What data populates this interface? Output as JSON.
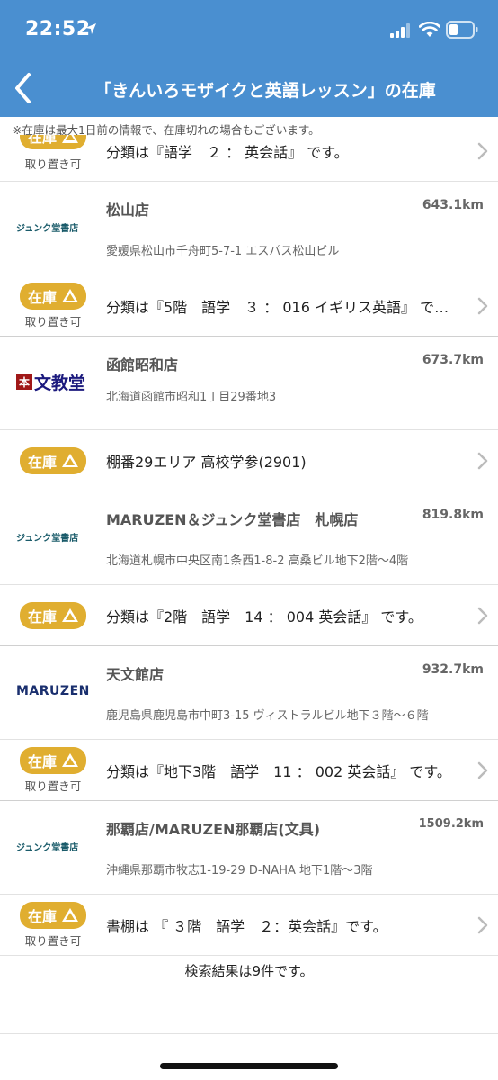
{
  "status_bar": {
    "time": "22:52"
  },
  "nav": {
    "title": "「きんいろモザイクと英語レッスン」の在庫"
  },
  "notice": "※在庫は最大1日前の情報で、在庫切れの場合もございます。",
  "stock_badge": "在庫",
  "hold_label": "取り置き可",
  "top_partial": {
    "shelf": "分類は『語学　２ ： 英会話』 です。",
    "hold": true
  },
  "stores": [
    {
      "logo": "ジュンク堂書店",
      "logo_type": "junku",
      "name": "松山店",
      "distance": "643.1km",
      "address": "愛媛県松山市千舟町5-7-1 エスパス松山ビル",
      "shelf": "分類は『5階　語学　３ ： 016 イギリス英語』 で…",
      "hold": true
    },
    {
      "logo": "文教堂",
      "logo_type": "bunkyo",
      "logo_mark": "本",
      "name": "函館昭和店",
      "distance": "673.7km",
      "address": "北海道函館市昭和1丁目29番地3",
      "shelf": "棚番29エリア 高校学参(2901)",
      "hold": false
    },
    {
      "logo": "ジュンク堂書店",
      "logo_type": "junku",
      "name": "MARUZEN＆ジュンク堂書店　札幌店",
      "distance": "819.8km",
      "address": "北海道札幌市中央区南1条西1-8-2 高桑ビル地下2階～4階",
      "shelf": "分類は『2階　語学　14 ： 004 英会話』 です。",
      "hold": false
    },
    {
      "logo": "MARUZEN",
      "logo_type": "maruzen",
      "name": "天文館店",
      "distance": "932.7km",
      "address": "鹿児島県鹿児島市中町3-15 ヴィストラルビル地下３階～６階",
      "shelf": "分類は『地下3階　語学　11 ： 002 英会話』 です。",
      "hold": true
    },
    {
      "logo": "ジュンク堂書店",
      "logo_type": "junku",
      "name": "那覇店/MARUZEN那覇店(文具)",
      "distance": "1509.2km",
      "address": "沖縄県那覇市牧志1-19-29 D-NAHA 地下1階～3階",
      "shelf": "書棚は 『 ３階　語学　２：英会話』です。",
      "hold": true
    }
  ],
  "result_count": "検索結果は9件です。",
  "colors": {
    "header": "#4a8fd0",
    "badge": "#e0ae30"
  },
  "icons": {
    "back": "chevron-left-icon",
    "row": "chevron-right-icon"
  }
}
